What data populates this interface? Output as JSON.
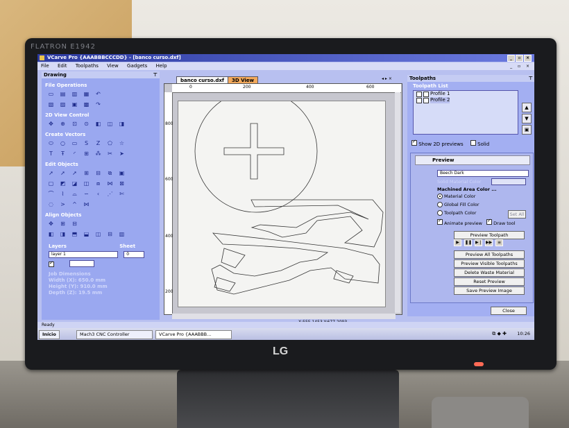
{
  "monitor": {
    "brand_top": "FLATRON E1942",
    "brand_bottom": "LG"
  },
  "window": {
    "title": "VCarve Pro {AAABBBCCCDD} - [banco curso.dxf]",
    "menu": [
      "File",
      "Edit",
      "Toolpaths",
      "View",
      "Gadgets",
      "Help"
    ]
  },
  "drawing_panel": {
    "header": "Drawing",
    "sections": [
      "File Operations",
      "2D View Control",
      "Create Vectors",
      "Edit Objects",
      "Align Objects"
    ],
    "layers_label": "Layers",
    "sheet_label": "Sheet",
    "layer_value": "layer 1",
    "sheet_value": "0",
    "job_dimensions_label": "Job Dimensions",
    "width": "Width  (X): 650.0 mm",
    "height": "Height (Y): 910.0 mm",
    "depth": "Depth  (Z): 19.5 mm"
  },
  "document": {
    "tabs": [
      "banco curso.dxf",
      "3D View"
    ],
    "ruler_h": [
      "0",
      "200",
      "400",
      "600"
    ],
    "ruler_v": [
      "800",
      "600",
      "400",
      "200"
    ],
    "coords": "X:555.1453 Y:677.2093"
  },
  "toolpaths_panel": {
    "header": "Toolpaths",
    "list_label": "Toolpath List",
    "items": [
      "Profile 1",
      "Profile 2"
    ],
    "show_2d_label": "Show 2D previews",
    "solid_label": "Solid",
    "preview_label": "Preview",
    "material": "Beech Dark",
    "solid_material_color": "Solid Material Color",
    "machined_area_color": "Machined Area Color ...",
    "radio_material": "Material Color",
    "radio_global": "Global Fill Color",
    "radio_toolpath": "Toolpath Color",
    "set_all": "Set All",
    "animate_preview": "Animate preview",
    "draw_tool": "Draw tool",
    "buttons": [
      "Preview Toolpath",
      "Preview All Toolpaths",
      "Preview Visible Toolpaths",
      "Delete Waste Material",
      "Reset Preview",
      "Save Preview Image"
    ],
    "close": "Close"
  },
  "status": {
    "text": "Ready"
  },
  "taskbar": {
    "start": "Início",
    "items": [
      "Mach3 CNC Controller",
      "VCarve Pro {AAABBB..."
    ],
    "clock": "10:26"
  }
}
